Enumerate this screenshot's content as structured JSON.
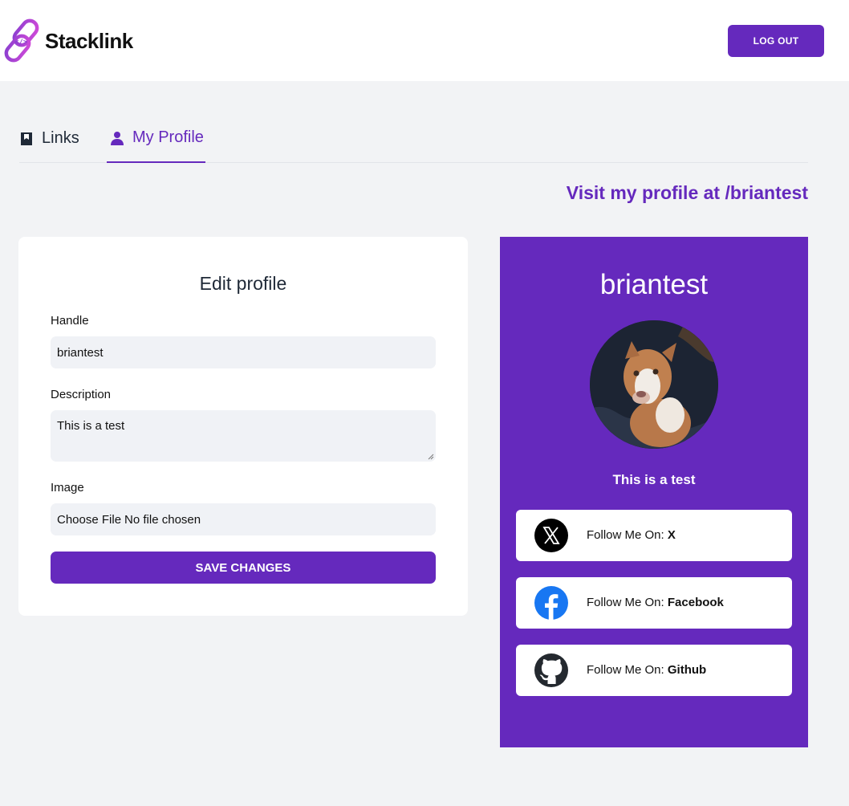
{
  "header": {
    "brand": "Stacklink",
    "logout_label": "LOG OUT"
  },
  "tabs": [
    {
      "label": "Links",
      "icon": "bookmark-icon",
      "active": false
    },
    {
      "label": "My Profile",
      "icon": "user-icon",
      "active": true
    }
  ],
  "visit_link": "Visit my profile at /briantest",
  "form": {
    "title": "Edit profile",
    "handle_label": "Handle",
    "handle_value": "briantest",
    "description_label": "Description",
    "description_value": "This is a test",
    "image_label": "Image",
    "file_button": "Choose File",
    "file_status": "No file chosen",
    "save_label": "SAVE CHANGES"
  },
  "preview": {
    "handle": "briantest",
    "description": "This is a test",
    "avatar_alt": "dog-photo",
    "links": [
      {
        "prefix": "Follow Me On:",
        "name": "X",
        "icon": "x-icon"
      },
      {
        "prefix": "Follow Me On:",
        "name": "Facebook",
        "icon": "facebook-icon"
      },
      {
        "prefix": "Follow Me On:",
        "name": "Github",
        "icon": "github-icon"
      }
    ]
  },
  "colors": {
    "accent": "#6529bd",
    "background": "#f2f3f5",
    "input_bg": "#f0f2f6"
  }
}
